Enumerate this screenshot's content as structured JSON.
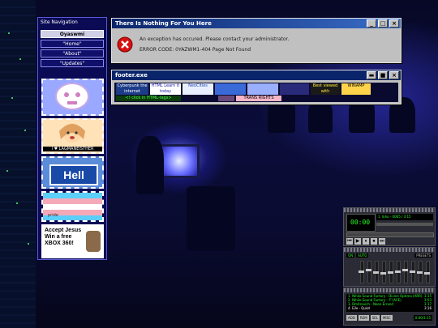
{
  "nav": {
    "title": "Site Navigation",
    "items": [
      {
        "label": "Oyaswmi",
        "active": true
      },
      {
        "label": "\"Home\"",
        "active": false
      },
      {
        "label": "\"About\"",
        "active": false
      },
      {
        "label": "\"Updates\"",
        "active": false
      }
    ],
    "stamps": [
      {
        "name": "ghost-stamp",
        "text": ""
      },
      {
        "name": "anime-girl-stamp",
        "text": "I ♥ LAGMANEISTHER"
      },
      {
        "name": "hell-sign-stamp",
        "text": "Hell"
      },
      {
        "name": "trans-flag-stamp",
        "text": "pride"
      },
      {
        "name": "accept-jesus-stamp",
        "text": "Accept Jesus Win a free XBOX 360!"
      }
    ]
  },
  "error_window": {
    "title": "There Is Nothing For You Here",
    "message": "An exception has occured. Please contact your administrator.",
    "code": "ERROR CODE: 0YAZWM1-404 Page Not Found",
    "buttons": [
      "_",
      "□",
      "×"
    ]
  },
  "footer_window": {
    "title": "footer.exe",
    "buttons": [
      "▬",
      "■",
      "×"
    ],
    "banners": [
      {
        "name": "banner-cyberpunk",
        "text": "Cyberpunk the internet",
        "bg": "#1c3b88",
        "fg": "#ffffff"
      },
      {
        "name": "banner-html",
        "text": "HTML Learn it today",
        "bg": "#ffffff",
        "fg": "#1a1ab0"
      },
      {
        "name": "banner-neocities",
        "text": "NeoCities",
        "bg": "#e8f0ff",
        "fg": "#2244aa"
      },
      {
        "name": "banner-pixel",
        "text": "",
        "bg": "#3a6ad8",
        "fg": "#ffffff"
      },
      {
        "name": "banner-glitter",
        "text": "",
        "bg": "#9ab0ff",
        "fg": "#ffffff"
      },
      {
        "name": "banner-stars",
        "text": "",
        "bg": "#2a2a7a",
        "fg": "#ffffff"
      },
      {
        "name": "banner-best-viewed",
        "text": "Best viewed with",
        "bg": "#1a1a1a",
        "fg": "#ffeb3b"
      },
      {
        "name": "banner-winamp",
        "text": "WINAMP",
        "bg": "#ffd44a",
        "fg": "#000000"
      }
    ],
    "row2": [
      {
        "name": "banner-click-html",
        "text": "<! click in HTML-tags>",
        "bg": "#0b3b0b",
        "fg": "#4cff4c"
      },
      {
        "name": "banner-anime",
        "text": "",
        "bg": "#6a4a7a",
        "fg": "#ffffff"
      },
      {
        "name": "banner-trans-rights",
        "text": "TRANS RIGHTS",
        "bg": "#f5b6c8",
        "fg": "#000000"
      }
    ]
  },
  "winamp": {
    "title": "WINAMP",
    "track": "1. Ikho - 0065 / 3:15",
    "time": "00:00",
    "eq_title": "WINAMP EQUALIZER",
    "eq_buttons": [
      "ON",
      "AUTO",
      "PRESETS"
    ],
    "eq_levels": [
      0.55,
      0.6,
      0.5,
      0.45,
      0.5,
      0.55,
      0.6,
      0.55,
      0.5,
      0.45
    ],
    "playlist_title": "WINAMP PLAYLIST",
    "playlist": [
      {
        "title": "1. Nihilo Sound Factory - Divine Optima (ARR)",
        "time": "3:15",
        "sel": false
      },
      {
        "title": "2. Nihilo Sound Factory - 'F'(ACE)",
        "time": "3:53",
        "sel": false
      },
      {
        "title": "3. Dmitrovich - Neon Errand",
        "time": "3:17",
        "sel": false
      },
      {
        "title": "4. Eile - Quiet",
        "time": "3:16",
        "sel": true
      }
    ],
    "pl_buttons": [
      "ADD",
      "REM",
      "SEL",
      "MISC"
    ],
    "pl_time": "0:00/3:15"
  }
}
